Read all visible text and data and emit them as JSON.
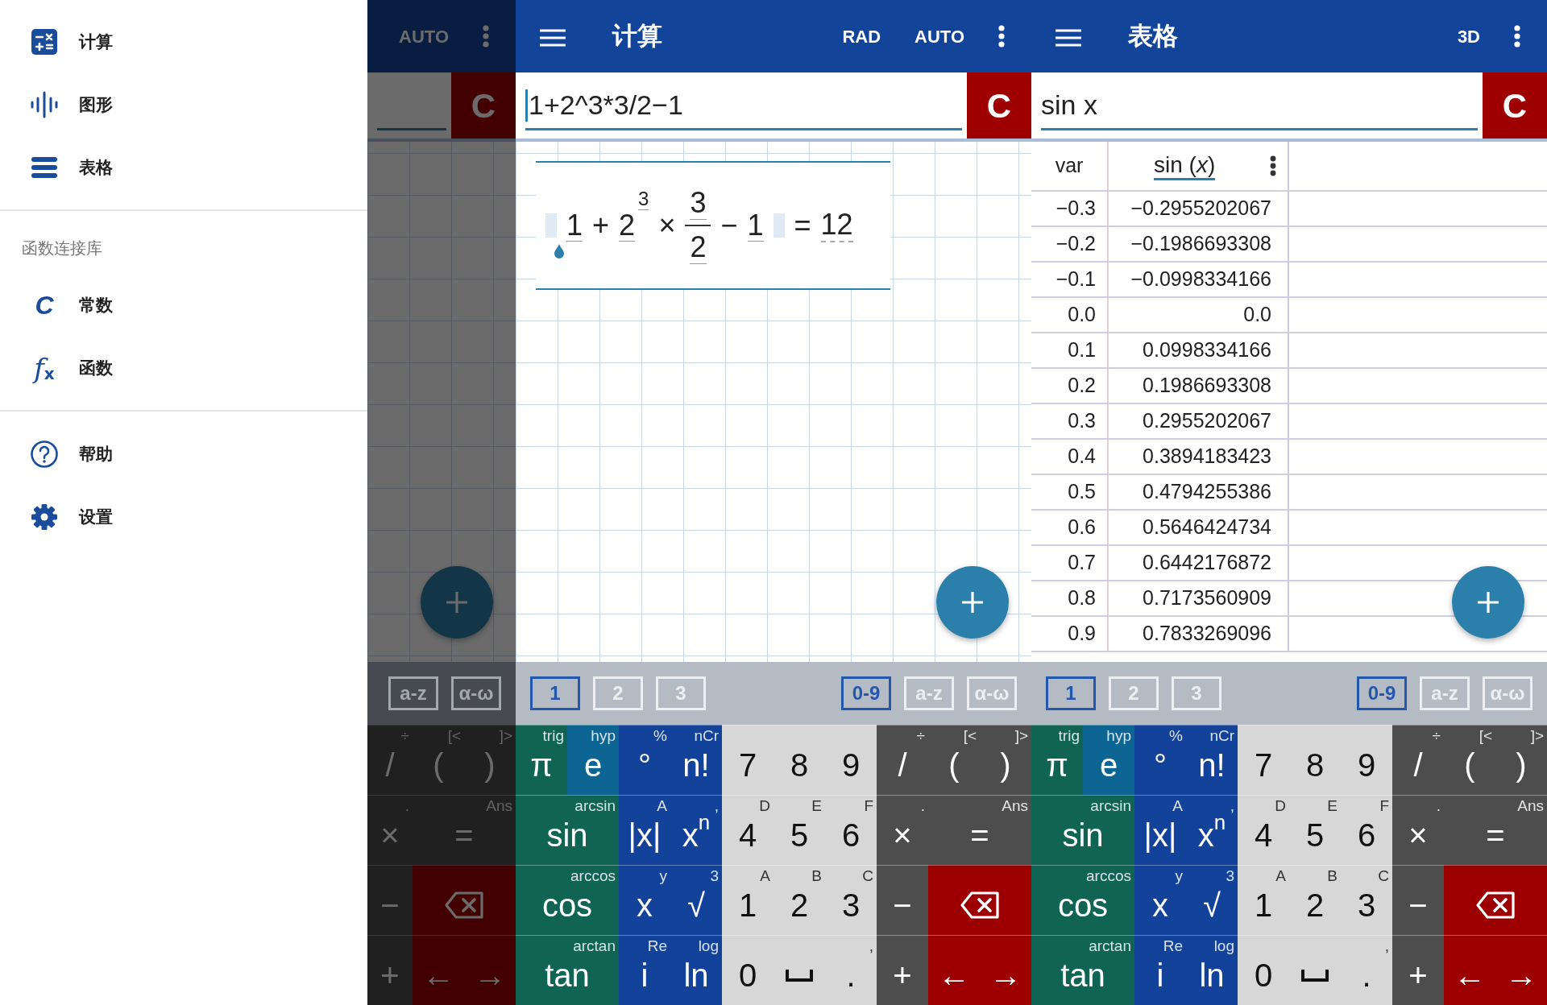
{
  "drawer": {
    "groups": [
      {
        "items": [
          {
            "kind": "calculator",
            "label": "计算"
          },
          {
            "kind": "graph",
            "label": "图形"
          },
          {
            "kind": "table",
            "label": "表格"
          }
        ]
      },
      {
        "header": "函数连接库",
        "items": [
          {
            "kind": "letter",
            "glyph": "C",
            "label": "常数"
          },
          {
            "kind": "letter",
            "glyph": "f$_{x}$",
            "label": "函数"
          }
        ]
      },
      {
        "items": [
          {
            "kind": "help",
            "label": "帮助"
          },
          {
            "kind": "settings",
            "label": "设置"
          }
        ]
      }
    ]
  },
  "background_pane": {
    "dimmed": true,
    "toolbar": {
      "actions": [
        "AUTO"
      ]
    },
    "clear_button": "C",
    "keyboards": [
      {
        "label": "a-z",
        "selected": false
      },
      {
        "label": "α-ω",
        "selected": false
      }
    ],
    "keypad": [
      {
        "label": "/",
        "alt": "÷",
        "kind": "op",
        "wide": false
      },
      {
        "label": "(",
        "alt": "[<",
        "kind": "op",
        "wide": false
      },
      {
        "label": ")",
        "alt": "]>",
        "kind": "op",
        "wide": false
      },
      {
        "label": "×",
        "alt": ".",
        "kind": "op",
        "wide": false
      },
      {
        "label": "=",
        "alt": "Ans",
        "kind": "op",
        "wide": true
      },
      {
        "label": "−",
        "kind": "op",
        "wide": false
      },
      {
        "kind": "delete",
        "wide": true
      },
      {
        "label": "+",
        "kind": "op",
        "wide": false
      },
      {
        "label": "←",
        "kind": "nav",
        "wide": false
      },
      {
        "label": "→",
        "kind": "nav",
        "wide": false
      }
    ]
  },
  "calculator_pane": {
    "dimmed": false,
    "toolbar": {
      "title": "计算",
      "actions": [
        "RAD",
        "AUTO"
      ]
    },
    "input": {
      "value": "1+2^3*3/2−1"
    },
    "clear_button": "C",
    "result": [
      {
        "kind": "slot"
      },
      {
        "kind": "num",
        "text": "1"
      },
      {
        "kind": "op",
        "text": "+"
      },
      {
        "kind": "pow",
        "base": "2",
        "exponent": "3"
      },
      {
        "kind": "op",
        "text": "×"
      },
      {
        "kind": "frac",
        "numerator": "3",
        "denominator": "2"
      },
      {
        "kind": "op",
        "text": "−"
      },
      {
        "kind": "num",
        "text": "1"
      },
      {
        "kind": "slot"
      },
      {
        "kind": "op",
        "text": "="
      },
      {
        "kind": "result",
        "text": "12"
      }
    ],
    "pages": [
      {
        "label": "1",
        "selected": true
      },
      {
        "label": "2",
        "selected": false
      },
      {
        "label": "3",
        "selected": false
      }
    ],
    "keyboards": [
      {
        "label": "0-9",
        "selected": true
      },
      {
        "label": "a-z",
        "selected": false
      },
      {
        "label": "α-ω",
        "selected": false
      }
    ],
    "keypad": [
      {
        "label": "π",
        "alt": "trig",
        "kind": "trig",
        "wide": false
      },
      {
        "label": "e",
        "alt": "hyp",
        "kind": "hyp",
        "wide": false
      },
      {
        "label": "°",
        "alt": "%",
        "kind": "func",
        "wide": false
      },
      {
        "label": "n!",
        "alt": "nCr",
        "kind": "func",
        "wide": false
      },
      {
        "label": "7",
        "kind": "digit",
        "wide": false
      },
      {
        "label": "8",
        "kind": "digit",
        "wide": false
      },
      {
        "label": "9",
        "kind": "digit",
        "wide": false
      },
      {
        "label": "/",
        "alt": "÷",
        "kind": "op",
        "wide": false
      },
      {
        "label": "(",
        "alt": "[<",
        "kind": "op",
        "wide": false
      },
      {
        "label": ")",
        "alt": "]>",
        "kind": "op",
        "wide": false
      },
      {
        "label": "sin",
        "alt": "arcsin",
        "kind": "trig",
        "wide": true
      },
      {
        "label": "|x|",
        "alt": "A",
        "kind": "func",
        "wide": false
      },
      {
        "label": "x$^{n}$",
        "alt": ",",
        "kind": "func",
        "wide": false
      },
      {
        "label": "4",
        "alt": "D",
        "kind": "digit",
        "wide": false
      },
      {
        "label": "5",
        "alt": "E",
        "kind": "digit",
        "wide": false
      },
      {
        "label": "6",
        "alt": "F",
        "kind": "digit",
        "wide": false
      },
      {
        "label": "×",
        "alt": ".",
        "kind": "op",
        "wide": false
      },
      {
        "label": "=",
        "alt": "Ans",
        "kind": "op",
        "wide": true
      },
      {
        "label": "cos",
        "alt": "arccos",
        "kind": "trig",
        "wide": true
      },
      {
        "label": "x",
        "alt": "y",
        "kind": "func",
        "wide": false
      },
      {
        "label": "√",
        "alt": "3",
        "kind": "func",
        "wide": false
      },
      {
        "label": "1",
        "alt": "A",
        "kind": "digit",
        "wide": false
      },
      {
        "label": "2",
        "alt": "B",
        "kind": "digit",
        "wide": false
      },
      {
        "label": "3",
        "alt": "C",
        "kind": "digit",
        "wide": false
      },
      {
        "label": "−",
        "kind": "op",
        "wide": false
      },
      {
        "kind": "delete",
        "wide": true
      },
      {
        "label": "tan",
        "alt": "arctan",
        "kind": "trig",
        "wide": true
      },
      {
        "label": "i",
        "alt": "Re",
        "kind": "func",
        "wide": false
      },
      {
        "label": "ln",
        "alt": "log",
        "kind": "func",
        "wide": false
      },
      {
        "label": "0",
        "kind": "digit",
        "wide": false
      },
      {
        "kind": "space",
        "wide": false
      },
      {
        "label": ".",
        "alt": ",",
        "kind": "digit",
        "wide": false
      },
      {
        "label": "+",
        "kind": "op",
        "wide": false
      },
      {
        "label": "←",
        "kind": "nav",
        "wide": false
      },
      {
        "label": "→",
        "kind": "nav",
        "wide": false
      }
    ]
  },
  "table_pane": {
    "dimmed": false,
    "toolbar": {
      "title": "表格",
      "actions": [
        "3D"
      ]
    },
    "input": {
      "value": "sin x"
    },
    "clear_button": "C",
    "table": {
      "columns": [
        "var",
        "sin (*x*)"
      ],
      "rows": [
        [
          "−0.3",
          "−0.2955202067"
        ],
        [
          "−0.2",
          "−0.1986693308"
        ],
        [
          "−0.1",
          "−0.0998334166"
        ],
        [
          "0.0",
          "0.0"
        ],
        [
          "0.1",
          "0.0998334166"
        ],
        [
          "0.2",
          "0.1986693308"
        ],
        [
          "0.3",
          "0.2955202067"
        ],
        [
          "0.4",
          "0.3894183423"
        ],
        [
          "0.5",
          "0.4794255386"
        ],
        [
          "0.6",
          "0.5646424734"
        ],
        [
          "0.7",
          "0.6442176872"
        ],
        [
          "0.8",
          "0.7173560909"
        ],
        [
          "0.9",
          "0.7833269096"
        ]
      ]
    },
    "pages": [
      {
        "label": "1",
        "selected": true
      },
      {
        "label": "2",
        "selected": false
      },
      {
        "label": "3",
        "selected": false
      }
    ],
    "keyboards": [
      {
        "label": "0-9",
        "selected": true
      },
      {
        "label": "a-z",
        "selected": false
      },
      {
        "label": "α-ω",
        "selected": false
      }
    ],
    "keypad": [
      {
        "label": "π",
        "alt": "trig",
        "kind": "trig",
        "wide": false
      },
      {
        "label": "e",
        "alt": "hyp",
        "kind": "hyp",
        "wide": false
      },
      {
        "label": "°",
        "alt": "%",
        "kind": "func",
        "wide": false
      },
      {
        "label": "n!",
        "alt": "nCr",
        "kind": "func",
        "wide": false
      },
      {
        "label": "7",
        "kind": "digit",
        "wide": false
      },
      {
        "label": "8",
        "kind": "digit",
        "wide": false
      },
      {
        "label": "9",
        "kind": "digit",
        "wide": false
      },
      {
        "label": "/",
        "alt": "÷",
        "kind": "op",
        "wide": false
      },
      {
        "label": "(",
        "alt": "[<",
        "kind": "op",
        "wide": false
      },
      {
        "label": ")",
        "alt": "]>",
        "kind": "op",
        "wide": false
      },
      {
        "label": "sin",
        "alt": "arcsin",
        "kind": "trig",
        "wide": true
      },
      {
        "label": "|x|",
        "alt": "A",
        "kind": "func",
        "wide": false
      },
      {
        "label": "x$^{n}$",
        "alt": ",",
        "kind": "func",
        "wide": false
      },
      {
        "label": "4",
        "alt": "D",
        "kind": "digit",
        "wide": false
      },
      {
        "label": "5",
        "alt": "E",
        "kind": "digit",
        "wide": false
      },
      {
        "label": "6",
        "alt": "F",
        "kind": "digit",
        "wide": false
      },
      {
        "label": "×",
        "alt": ".",
        "kind": "op",
        "wide": false
      },
      {
        "label": "=",
        "alt": "Ans",
        "kind": "op",
        "wide": true
      },
      {
        "label": "cos",
        "alt": "arccos",
        "kind": "trig",
        "wide": true
      },
      {
        "label": "x",
        "alt": "y",
        "kind": "func",
        "wide": false
      },
      {
        "label": "√",
        "alt": "3",
        "kind": "func",
        "wide": false
      },
      {
        "label": "1",
        "alt": "A",
        "kind": "digit",
        "wide": false
      },
      {
        "label": "2",
        "alt": "B",
        "kind": "digit",
        "wide": false
      },
      {
        "label": "3",
        "alt": "C",
        "kind": "digit",
        "wide": false
      },
      {
        "label": "−",
        "kind": "op",
        "wide": false
      },
      {
        "kind": "delete",
        "wide": true
      },
      {
        "label": "tan",
        "alt": "arctan",
        "kind": "trig",
        "wide": true
      },
      {
        "label": "i",
        "alt": "Re",
        "kind": "func",
        "wide": false
      },
      {
        "label": "ln",
        "alt": "log",
        "kind": "func",
        "wide": false
      },
      {
        "label": "0",
        "kind": "digit",
        "wide": false
      },
      {
        "kind": "space",
        "wide": false
      },
      {
        "label": ".",
        "alt": ",",
        "kind": "digit",
        "wide": false
      },
      {
        "label": "+",
        "kind": "op",
        "wide": false
      },
      {
        "label": "←",
        "kind": "nav",
        "wide": false
      },
      {
        "label": "→",
        "kind": "nav",
        "wide": false
      }
    ]
  }
}
